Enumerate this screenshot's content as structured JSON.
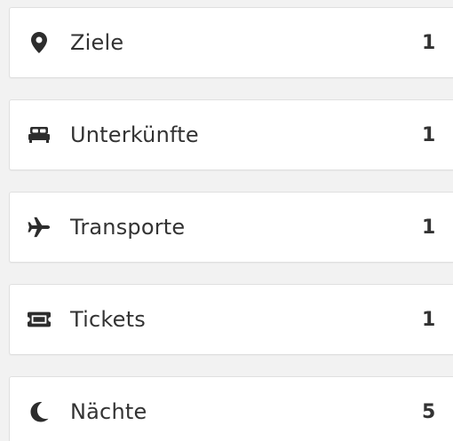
{
  "stats": {
    "items": [
      {
        "icon": "map-marker-icon",
        "label": "Ziele",
        "count": "1"
      },
      {
        "icon": "bed-icon",
        "label": "Unterkünfte",
        "count": "1"
      },
      {
        "icon": "plane-icon",
        "label": "Transporte",
        "count": "1"
      },
      {
        "icon": "ticket-icon",
        "label": "Tickets",
        "count": "1"
      },
      {
        "icon": "moon-icon",
        "label": "Nächte",
        "count": "5"
      }
    ]
  },
  "colors": {
    "background": "#f2f2f2",
    "card": "#ffffff",
    "text": "#333333",
    "icon": "#2d2d2d"
  }
}
